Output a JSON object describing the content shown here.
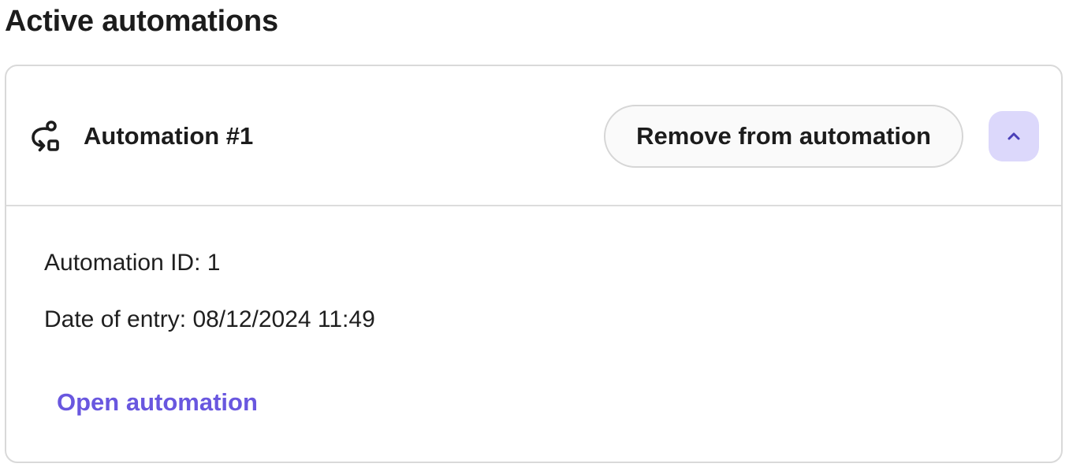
{
  "page": {
    "title": "Active automations"
  },
  "automation": {
    "title": "Automation #1",
    "icon": "workflow-icon",
    "remove_label": "Remove from automation",
    "collapse_icon": "chevron-up-icon",
    "id_label": "Automation ID:",
    "id_value": "1",
    "date_label": "Date of entry:",
    "date_value": "08/12/2024 11:49",
    "open_label": "Open automation"
  },
  "colors": {
    "accent": "#6957df",
    "collapse_button_bg": "#dcd8fb",
    "chevron": "#4a3fb8",
    "border": "#d9d9d9"
  }
}
